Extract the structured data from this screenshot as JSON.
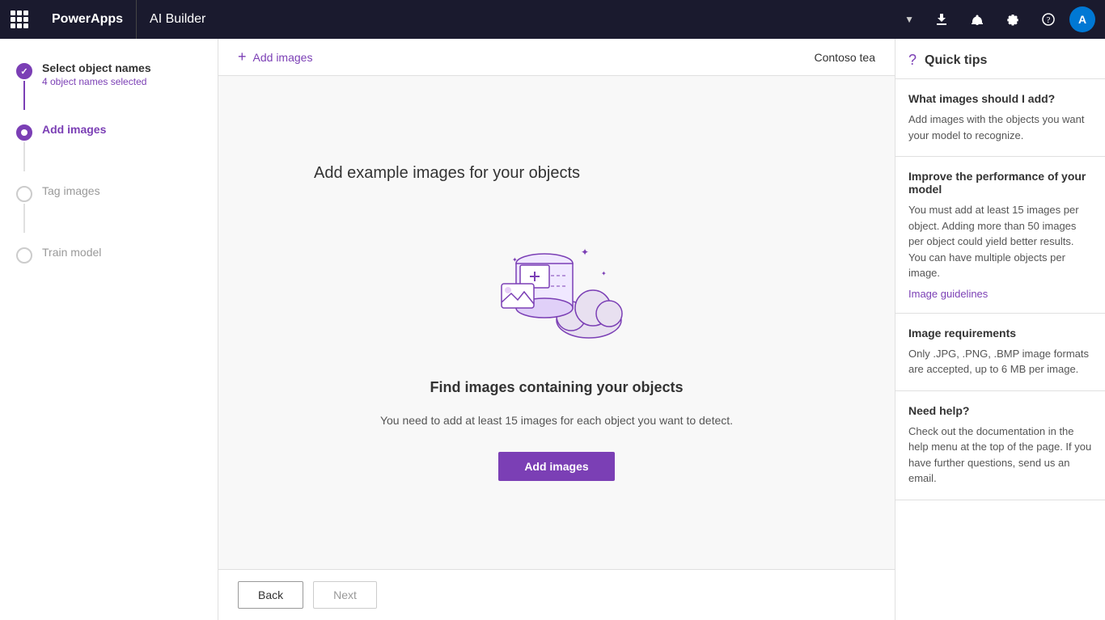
{
  "nav": {
    "waffle_label": "App launcher",
    "app_title": "PowerApps",
    "app_subtitle": "AI Builder",
    "contoso_label": "Contoso tea",
    "dropdown_label": "dropdown",
    "download_label": "Download",
    "notifications_label": "Notifications",
    "settings_label": "Settings",
    "help_label": "Help",
    "avatar_label": "User account"
  },
  "sidebar": {
    "steps": [
      {
        "id": "select-object-names",
        "title": "Select object names",
        "subtitle": "4 object names selected",
        "status": "completed"
      },
      {
        "id": "add-images",
        "title": "Add images",
        "subtitle": "",
        "status": "active"
      },
      {
        "id": "tag-images",
        "title": "Tag images",
        "subtitle": "",
        "status": "inactive"
      },
      {
        "id": "train-model",
        "title": "Train model",
        "subtitle": "",
        "status": "inactive"
      }
    ]
  },
  "content": {
    "breadcrumb_add": "Add images",
    "page_title": "Add example images for your objects",
    "illustration_alt": "Add images illustration",
    "find_images_title": "Find images containing your objects",
    "find_images_desc": "You need to add at least 15 images for each object you want to detect.",
    "add_images_btn": "Add images"
  },
  "footer": {
    "back_label": "Back",
    "next_label": "Next"
  },
  "quick_tips": {
    "title": "Quick tips",
    "cards": [
      {
        "title": "What images should I add?",
        "text": "Add images with the objects you want your model to recognize.",
        "link": null
      },
      {
        "title": "Improve the performance of your model",
        "text": "You must add at least 15 images per object. Adding more than 50 images per object could yield better results. You can have multiple objects per image.",
        "link": "Image guidelines"
      },
      {
        "title": "Image requirements",
        "text": "Only .JPG, .PNG, .BMP image formats are accepted, up to 6 MB per image.",
        "link": null
      },
      {
        "title": "Need help?",
        "text": "Check out the documentation in the help menu at the top of the page. If you have further questions, send us an email.",
        "link": null
      }
    ]
  }
}
